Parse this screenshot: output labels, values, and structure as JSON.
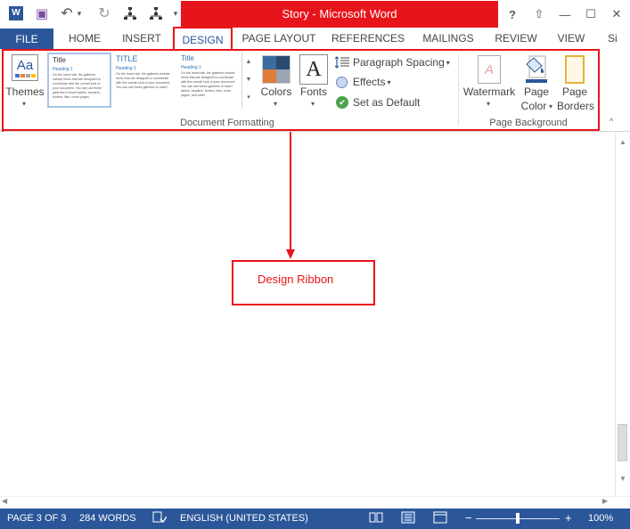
{
  "window": {
    "title": "Story -  Microsoft Word",
    "help_glyph": "?",
    "restore_ribbon_glyph": "⇧",
    "minimize_glyph": "—",
    "maximize_glyph": "☐",
    "close_glyph": "✕"
  },
  "quick_access": {
    "word_logo": "W",
    "save_glyph": "▣",
    "undo_glyph": "↶",
    "undo_arrow": "▾",
    "redo_glyph": "↻",
    "customize_glyph": "▾"
  },
  "tabs": [
    {
      "label": "FILE"
    },
    {
      "label": "HOME"
    },
    {
      "label": "INSERT"
    },
    {
      "label": "DESIGN"
    },
    {
      "label": "PAGE LAYOUT"
    },
    {
      "label": "REFERENCES"
    },
    {
      "label": "MAILINGS"
    },
    {
      "label": "REVIEW"
    },
    {
      "label": "VIEW"
    },
    {
      "label": "Si"
    }
  ],
  "ribbon": {
    "themes_label": "Themes",
    "themes_icon_text": "Aa",
    "gallery": [
      {
        "title": "Title",
        "heading": "Heading 1",
        "body": "On the Insert tab, the galleries include items that are designed to coordinate with the overall look of your document. You can use these galleries to insert tables, headers, footers, lists, cover pages,"
      },
      {
        "title": "TITLE",
        "heading": "Heading 1",
        "body": "On the Insert tab, the galleries include items that are designed to coordinate with the overall look of your document. You can use these galleries to insert"
      },
      {
        "title": "Title",
        "heading": "Heading 1",
        "body": "On the Insert tab, the galleries include items that are designed to coordinate with the overall look of your document. You can use these galleries to insert tables, headers, footers, lists, cover pages, and other"
      }
    ],
    "colors_label": "Colors",
    "colors_swatches": [
      "#3a6c9e",
      "#2b4a6f",
      "#e07b39",
      "#9aa5b1"
    ],
    "fonts_label": "Fonts",
    "fonts_icon_text": "A",
    "paragraph_spacing_label": "Paragraph Spacing",
    "effects_label": "Effects",
    "set_default_label": "Set as Default",
    "set_default_glyph": "✔",
    "group_document_formatting": "Document Formatting",
    "watermark_label": "Watermark",
    "watermark_icon_text": "A",
    "page_color_label_1": "Page",
    "page_color_label_2": "Color",
    "page_borders_label_1": "Page",
    "page_borders_label_2": "Borders",
    "group_page_background": "Page Background",
    "dropdown_glyph": "▾",
    "collapse_glyph": "^"
  },
  "annotation": {
    "callout_text": "Design Ribbon",
    "color": "#e8141b"
  },
  "statusbar": {
    "page": "PAGE 3 OF 3",
    "words": "284 WORDS",
    "language": "ENGLISH (UNITED STATES)",
    "zoom_minus": "−",
    "zoom_plus": "+",
    "zoom": "100%",
    "zoom_fraction": 0.5
  },
  "colors": {
    "accent": "#2b579a",
    "annotation_red": "#e8141b"
  }
}
